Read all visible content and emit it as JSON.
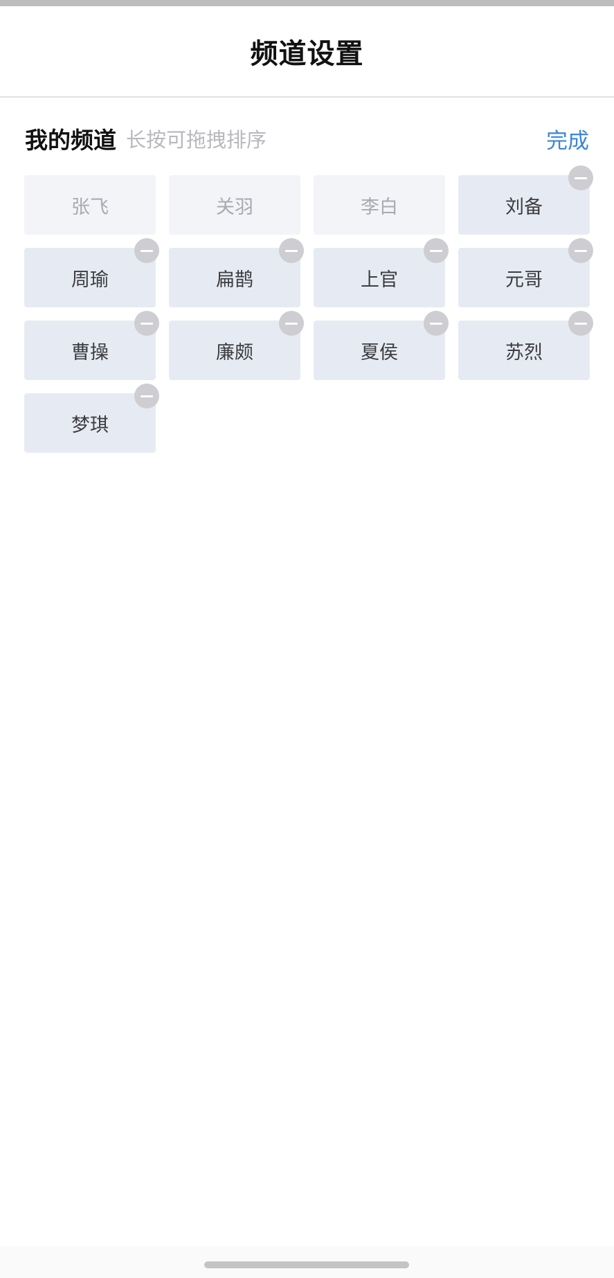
{
  "nav": {
    "title": "频道设置"
  },
  "section": {
    "title": "我的频道",
    "hint": "长按可拖拽排序",
    "done_label": "完成"
  },
  "colors": {
    "accent": "#3a86d9",
    "tile_bg": "#e6ebf3",
    "tile_fixed_bg": "#f3f4f8",
    "remove_badge": "#cdcdd2"
  },
  "icons": {
    "remove": "minus-circle-icon"
  },
  "channels": [
    {
      "label": "张飞",
      "fixed": true
    },
    {
      "label": "关羽",
      "fixed": true
    },
    {
      "label": "李白",
      "fixed": true
    },
    {
      "label": "刘备",
      "fixed": false
    },
    {
      "label": "周瑜",
      "fixed": false
    },
    {
      "label": "扁鹊",
      "fixed": false
    },
    {
      "label": "上官",
      "fixed": false
    },
    {
      "label": "元哥",
      "fixed": false
    },
    {
      "label": "曹操",
      "fixed": false
    },
    {
      "label": "廉颇",
      "fixed": false
    },
    {
      "label": "夏侯",
      "fixed": false
    },
    {
      "label": "苏烈",
      "fixed": false
    },
    {
      "label": "梦琪",
      "fixed": false
    }
  ]
}
